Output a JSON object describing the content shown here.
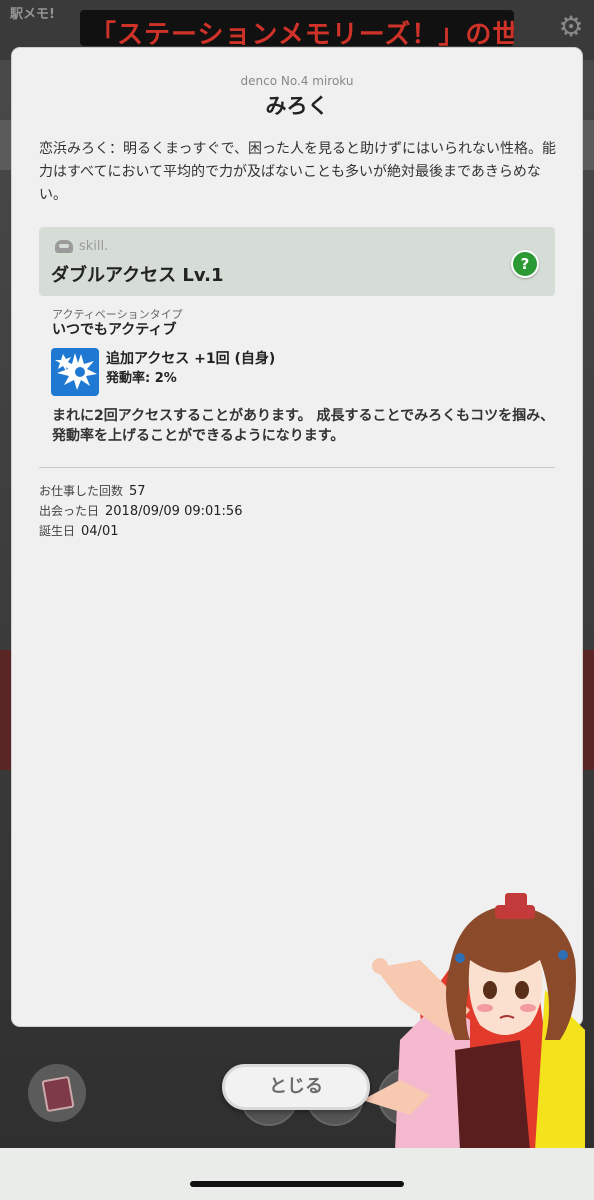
{
  "app": {
    "logo_line1": "駅メモ!",
    "marquee_text": "「ステーションメモリーズ！」の世界へ",
    "settings_icon": "gear-icon"
  },
  "dialog": {
    "subtitle": "denco No.4 miroku",
    "title": "みろく",
    "description": "恋浜みろく：明るくまっすぐで、困った人を見ると助けずにはいられない性格。能力はすべてにおいて平均的で力が及ばないことも多いが絶対最後まであきらめない。",
    "skill": {
      "label": "skill.",
      "name": "ダブルアクセス Lv.1",
      "help_label": "?",
      "activation_type_label": "アクティベーションタイプ",
      "activation_type_value": "いつでもアクティブ",
      "effect_name": "追加アクセス +1回 (自身)",
      "effect_rate": "発動率: 2%",
      "text": "まれに2回アクセスすることがあります。 成長することでみろくもコツを掴み、発動率を上げることができるようになります。",
      "icon_color": "#1f78d1"
    },
    "stats": [
      {
        "label": "お仕事した回数",
        "value": "57"
      },
      {
        "label": "出会った日",
        "value": "2018/09/09 09:01:56"
      },
      {
        "label": "誕生日",
        "value": "04/01"
      }
    ],
    "close_label": "とじる"
  },
  "colors": {
    "help_green": "#2b9a34",
    "skill_box": "#d6ddd6",
    "marquee_red": "#ff3b2f"
  }
}
